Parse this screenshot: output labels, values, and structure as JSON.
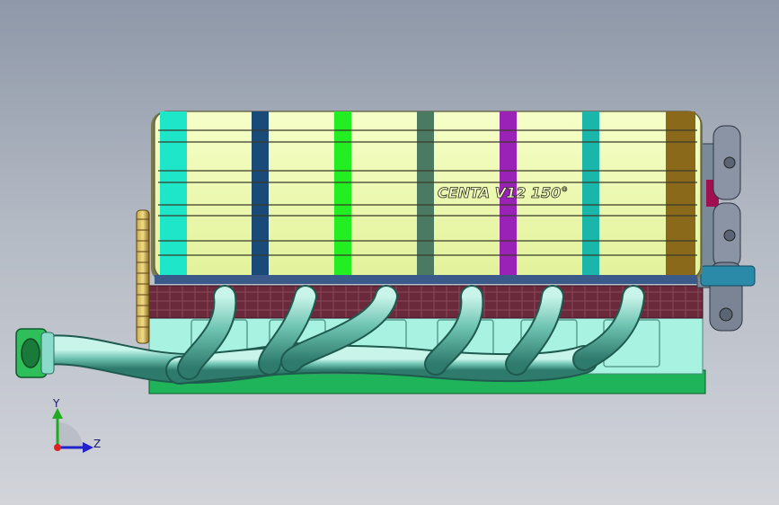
{
  "viewport": {
    "background_top": "#8e98a8",
    "background_bottom": "#d2d4da"
  },
  "model": {
    "engraving": "CENTA V12  150°",
    "valve_cover_color": "#ecfaa6",
    "block_color": "#a8f2e2",
    "header_pipe_color": "#6fc4b2",
    "base_plate_color": "#1fb35a",
    "crankcase_color": "#6a2a3c",
    "band_colors": [
      "#1ee6c8",
      "#1a4a78",
      "#22ee22",
      "#4a7a62",
      "#9a22b6",
      "#1ab6aa",
      "#8a6a1a"
    ]
  },
  "triad": {
    "y_label": "Y",
    "z_label": "Z",
    "y_axis_color": "#22aa22",
    "z_axis_color": "#2222cc",
    "origin_color": "#dd2222"
  }
}
